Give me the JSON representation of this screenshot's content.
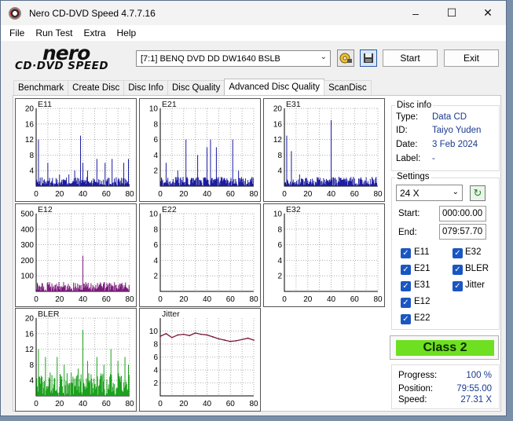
{
  "window": {
    "title": "Nero CD-DVD Speed 4.7.7.16"
  },
  "menu": [
    "File",
    "Run Test",
    "Extra",
    "Help"
  ],
  "logo": {
    "line1": "nero",
    "line2": "CD·DVD SPEED"
  },
  "toolbar": {
    "drive": "[7:1]   BENQ DVD DD DW1640 BSLB",
    "start_label": "Start",
    "exit_label": "Exit"
  },
  "tabs": [
    "Benchmark",
    "Create Disc",
    "Disc Info",
    "Disc Quality",
    "Advanced Disc Quality",
    "ScanDisc"
  ],
  "active_tab": "Advanced Disc Quality",
  "disc_info": {
    "title": "Disc info",
    "type_label": "Type:",
    "type": "Data CD",
    "id_label": "ID:",
    "id": "Taiyo Yuden",
    "date_label": "Date:",
    "date": "3 Feb 2024",
    "label_label": "Label:",
    "label": "-"
  },
  "settings": {
    "title": "Settings",
    "speed": "24 X",
    "start_label": "Start:",
    "start": "000:00.00",
    "end_label": "End:",
    "end": "079:57.70",
    "checks": [
      "E11",
      "E21",
      "E31",
      "E12",
      "E22",
      "E32",
      "BLER",
      "Jitter"
    ]
  },
  "result": {
    "class": "Class 2"
  },
  "progress": {
    "progress_label": "Progress:",
    "progress": "100 %",
    "position_label": "Position:",
    "position": "79:55.00",
    "speed_label": "Speed:",
    "speed": "27.31 X"
  },
  "colors": {
    "e_series": "#1a1aa0",
    "e12_series": "#7a1a7a",
    "bler": "#1aa01a",
    "jitter": "#7a1a3a",
    "class_bg": "#6fe021"
  },
  "chart_data": [
    {
      "name": "E11",
      "type": "bar",
      "x_ticks": [
        0,
        20,
        40,
        60,
        80
      ],
      "y_ticks": [
        4,
        8,
        12,
        16,
        20
      ],
      "ylim": [
        0,
        20
      ],
      "xlim": [
        0,
        80
      ],
      "peaks": [
        [
          2,
          12
        ],
        [
          10,
          6
        ],
        [
          20,
          3
        ],
        [
          28,
          3
        ],
        [
          33,
          4
        ],
        [
          38,
          13
        ],
        [
          40,
          6
        ],
        [
          44,
          4
        ],
        [
          52,
          7
        ],
        [
          59,
          6
        ],
        [
          65,
          7
        ],
        [
          75,
          6
        ],
        [
          79,
          7
        ]
      ]
    },
    {
      "name": "E21",
      "type": "bar",
      "x_ticks": [
        0,
        20,
        40,
        60,
        80
      ],
      "y_ticks": [
        2,
        4,
        6,
        8,
        10
      ],
      "ylim": [
        0,
        10
      ],
      "xlim": [
        0,
        80
      ],
      "peaks": [
        [
          5,
          3
        ],
        [
          15,
          2
        ],
        [
          22,
          6
        ],
        [
          32,
          4
        ],
        [
          40,
          5
        ],
        [
          43,
          6
        ],
        [
          48,
          5
        ],
        [
          57,
          1
        ],
        [
          62,
          6
        ],
        [
          67,
          2
        ],
        [
          73,
          1
        ],
        [
          78,
          1
        ]
      ]
    },
    {
      "name": "E31",
      "type": "bar",
      "x_ticks": [
        0,
        20,
        40,
        60,
        80
      ],
      "y_ticks": [
        4,
        8,
        12,
        16,
        20
      ],
      "ylim": [
        0,
        20
      ],
      "xlim": [
        0,
        80
      ],
      "peaks": [
        [
          2,
          13
        ],
        [
          6,
          9
        ],
        [
          13,
          3
        ],
        [
          19,
          2
        ],
        [
          33,
          1
        ],
        [
          40,
          17
        ],
        [
          43,
          2
        ],
        [
          48,
          2
        ],
        [
          60,
          2
        ],
        [
          68,
          1
        ],
        [
          78,
          2
        ]
      ]
    },
    {
      "name": "E12",
      "type": "bar",
      "x_ticks": [
        0,
        20,
        40,
        60,
        80
      ],
      "y_ticks": [
        100,
        200,
        300,
        400,
        500
      ],
      "ylim": [
        0,
        500
      ],
      "xlim": [
        0,
        80
      ],
      "peaks": [
        [
          12,
          25
        ],
        [
          28,
          20
        ],
        [
          40,
          230
        ],
        [
          60,
          28
        ],
        [
          70,
          20
        ],
        [
          78,
          22
        ]
      ]
    },
    {
      "name": "E22",
      "type": "bar",
      "x_ticks": [
        0,
        20,
        40,
        60,
        80
      ],
      "y_ticks": [
        2,
        4,
        6,
        8,
        10
      ],
      "ylim": [
        0,
        10
      ],
      "xlim": [
        0,
        80
      ],
      "peaks": []
    },
    {
      "name": "E32",
      "type": "bar",
      "x_ticks": [
        0,
        20,
        40,
        60,
        80
      ],
      "y_ticks": [
        2,
        4,
        6,
        8,
        10
      ],
      "ylim": [
        0,
        10
      ],
      "xlim": [
        0,
        80
      ],
      "peaks": []
    },
    {
      "name": "BLER",
      "type": "bar",
      "x_ticks": [
        0,
        20,
        40,
        60,
        80
      ],
      "y_ticks": [
        4,
        8,
        12,
        16,
        20
      ],
      "ylim": [
        0,
        20
      ],
      "xlim": [
        0,
        80
      ],
      "peaks": [
        [
          2,
          12
        ],
        [
          8,
          10
        ],
        [
          12,
          6
        ],
        [
          18,
          10
        ],
        [
          24,
          8
        ],
        [
          30,
          6
        ],
        [
          36,
          7
        ],
        [
          40,
          17
        ],
        [
          44,
          9
        ],
        [
          52,
          10
        ],
        [
          58,
          8
        ],
        [
          64,
          12
        ],
        [
          70,
          9
        ],
        [
          76,
          10
        ],
        [
          79,
          8
        ]
      ]
    },
    {
      "name": "Jitter",
      "type": "line",
      "x_ticks": [
        0,
        20,
        40,
        60,
        80
      ],
      "y_ticks": [
        2,
        4,
        6,
        8,
        10
      ],
      "ylim": [
        0,
        12
      ],
      "xlim": [
        0,
        80
      ],
      "points": [
        [
          0,
          9.2
        ],
        [
          5,
          9.6
        ],
        [
          10,
          9.0
        ],
        [
          15,
          9.4
        ],
        [
          20,
          9.5
        ],
        [
          25,
          9.3
        ],
        [
          30,
          9.7
        ],
        [
          35,
          9.5
        ],
        [
          40,
          9.4
        ],
        [
          45,
          9.1
        ],
        [
          50,
          8.8
        ],
        [
          55,
          8.6
        ],
        [
          60,
          8.4
        ],
        [
          65,
          8.5
        ],
        [
          70,
          8.7
        ],
        [
          75,
          8.9
        ],
        [
          80,
          8.6
        ]
      ]
    }
  ]
}
